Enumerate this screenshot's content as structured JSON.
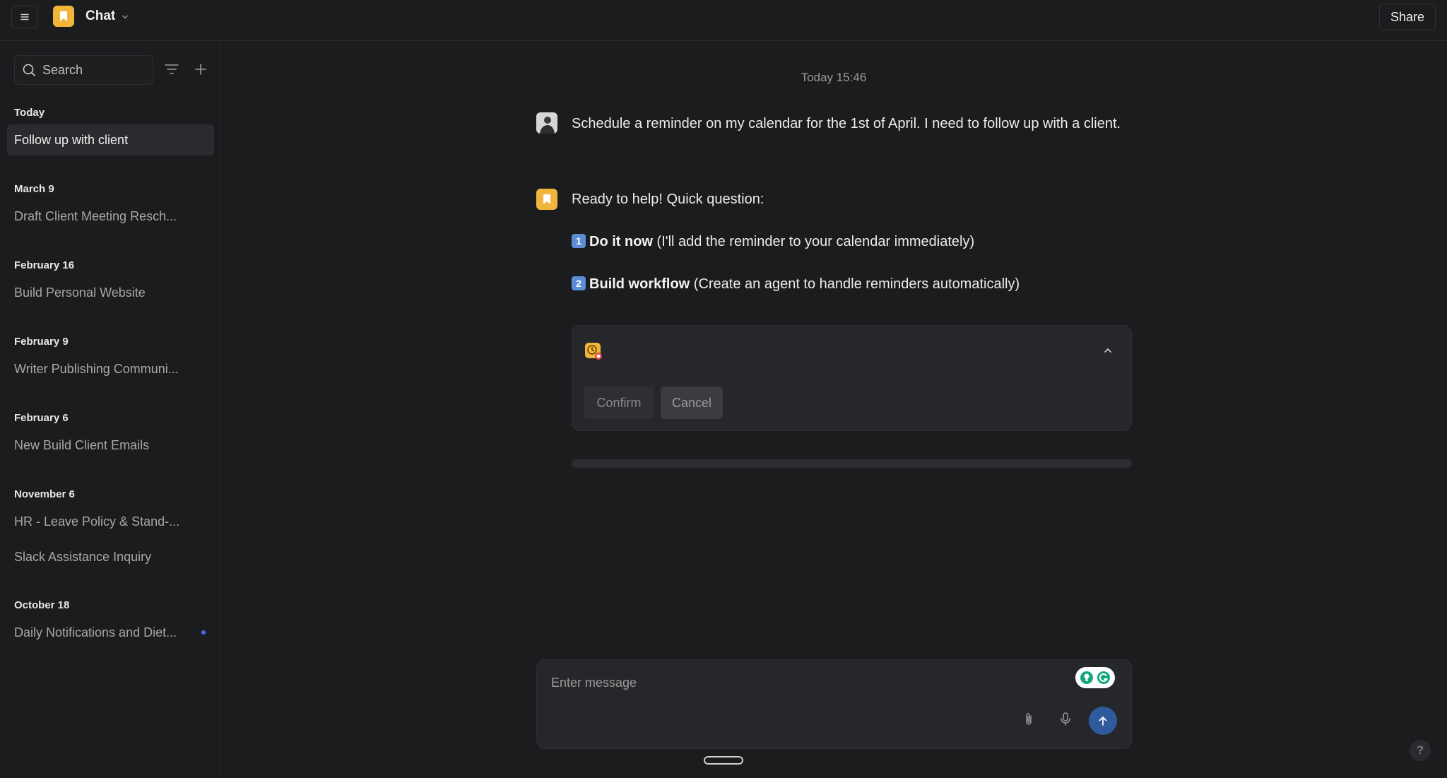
{
  "header": {
    "app_title": "Chat",
    "share_label": "Share"
  },
  "sidebar": {
    "search_placeholder": "Search",
    "groups": [
      {
        "label": "Today",
        "items": [
          {
            "title": "Follow up with client",
            "active": true
          }
        ]
      },
      {
        "label": "March 9",
        "items": [
          {
            "title": "Draft Client Meeting Resch..."
          }
        ]
      },
      {
        "label": "February 16",
        "items": [
          {
            "title": "Build Personal Website"
          }
        ]
      },
      {
        "label": "February 9",
        "items": [
          {
            "title": "Writer Publishing Communi..."
          }
        ]
      },
      {
        "label": "February 6",
        "items": [
          {
            "title": "New Build Client Emails"
          }
        ]
      },
      {
        "label": "November 6",
        "items": [
          {
            "title": "HR - Leave Policy & Stand-..."
          },
          {
            "title": "Slack Assistance Inquiry"
          }
        ]
      },
      {
        "label": "October 18",
        "items": [
          {
            "title": "Daily Notifications and Diet...",
            "unread": true
          }
        ]
      }
    ]
  },
  "chat": {
    "timestamp": "Today 15:46",
    "user_message": "Schedule a reminder on my calendar for the 1st of April. I need to follow up with a client.",
    "bot_intro": "Ready to help! Quick question:",
    "options": [
      {
        "num": "1",
        "title": "Do it now",
        "desc": "(I'll add the reminder to your calendar immediately)"
      },
      {
        "num": "2",
        "title": "Build workflow",
        "desc": "(Create an agent to handle reminders automatically)"
      }
    ],
    "confirm_label": "Confirm",
    "cancel_label": "Cancel",
    "progress": 0
  },
  "composer": {
    "placeholder": "Enter message"
  },
  "help_label": "?",
  "colors": {
    "accent": "#f2b53c",
    "send": "#2f5a9c",
    "unread": "#4b6cf2"
  }
}
